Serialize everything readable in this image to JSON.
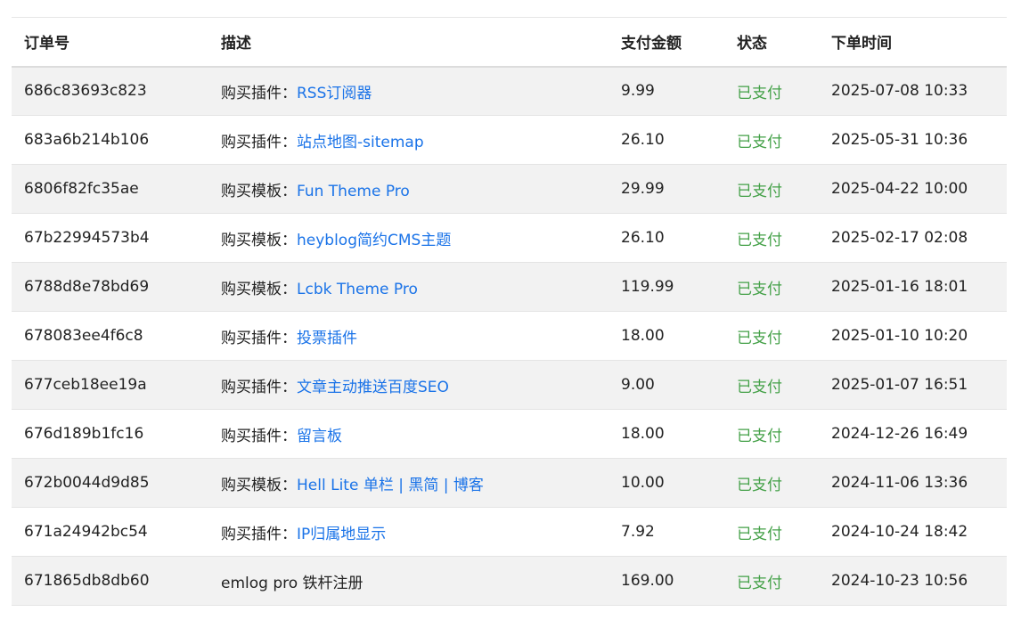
{
  "table": {
    "headers": {
      "order_id": "订单号",
      "description": "描述",
      "amount": "支付金额",
      "status": "状态",
      "order_time": "下单时间"
    },
    "colors": {
      "link": "#1a73e8",
      "status_paid": "#43a047",
      "row_stripe": "#f2f2f2"
    },
    "rows": [
      {
        "order_id": "686c83693c823",
        "prefix": "购买插件：",
        "item": "RSS订阅器",
        "amount": "9.99",
        "status": "已支付",
        "time": "2025-07-08 10:33"
      },
      {
        "order_id": "683a6b214b106",
        "prefix": "购买插件：",
        "item": "站点地图-sitemap",
        "amount": "26.10",
        "status": "已支付",
        "time": "2025-05-31 10:36"
      },
      {
        "order_id": "6806f82fc35ae",
        "prefix": "购买模板：",
        "item": "Fun Theme Pro",
        "amount": "29.99",
        "status": "已支付",
        "time": "2025-04-22 10:00"
      },
      {
        "order_id": "67b22994573b4",
        "prefix": "购买模板：",
        "item": "heyblog简约CMS主题",
        "amount": "26.10",
        "status": "已支付",
        "time": "2025-02-17 02:08"
      },
      {
        "order_id": "6788d8e78bd69",
        "prefix": "购买模板：",
        "item": "Lcbk Theme Pro",
        "amount": "119.99",
        "status": "已支付",
        "time": "2025-01-16 18:01"
      },
      {
        "order_id": "678083ee4f6c8",
        "prefix": "购买插件：",
        "item": "投票插件",
        "amount": "18.00",
        "status": "已支付",
        "time": "2025-01-10 10:20"
      },
      {
        "order_id": "677ceb18ee19a",
        "prefix": "购买插件：",
        "item": "文章主动推送百度SEO",
        "amount": "9.00",
        "status": "已支付",
        "time": "2025-01-07 16:51"
      },
      {
        "order_id": "676d189b1fc16",
        "prefix": "购买插件：",
        "item": "留言板",
        "amount": "18.00",
        "status": "已支付",
        "time": "2024-12-26 16:49"
      },
      {
        "order_id": "672b0044d9d85",
        "prefix": "购买模板：",
        "item": "Hell Lite 单栏 | 黑简 | 博客",
        "amount": "10.00",
        "status": "已支付",
        "time": "2024-11-06 13:36"
      },
      {
        "order_id": "671a24942bc54",
        "prefix": "购买插件：",
        "item": "IP归属地显示",
        "amount": "7.92",
        "status": "已支付",
        "time": "2024-10-24 18:42"
      },
      {
        "order_id": "671865db8db60",
        "prefix": "emlog pro 铁杆注册",
        "item": "",
        "amount": "169.00",
        "status": "已支付",
        "time": "2024-10-23 10:56"
      }
    ]
  }
}
